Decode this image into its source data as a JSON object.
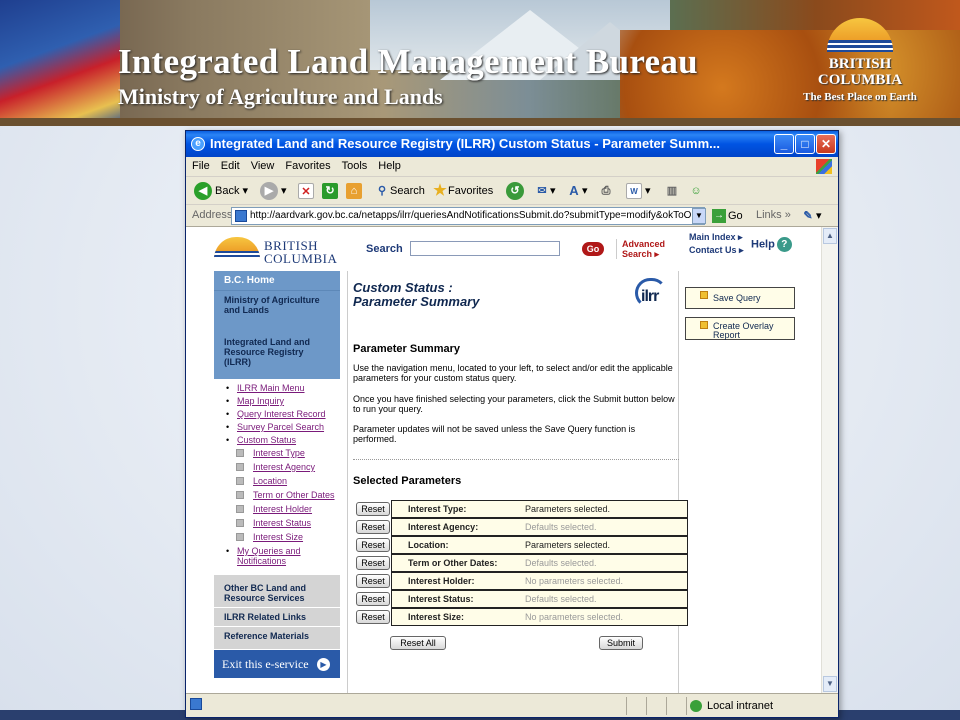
{
  "banner": {
    "title": "Integrated Land Management Bureau",
    "subtitle": "Ministry of Agriculture and Lands",
    "bc_name_1": "BRITISH",
    "bc_name_2": "COLUMBIA",
    "bc_tagline": "The Best Place on Earth"
  },
  "window": {
    "title": "Integrated Land and Resource Registry (ILRR) Custom Status - Parameter Summ...",
    "menu": [
      "File",
      "Edit",
      "View",
      "Favorites",
      "Tools",
      "Help"
    ],
    "toolbar": {
      "back": "Back",
      "search": "Search",
      "favorites": "Favorites"
    },
    "address_label": "Address",
    "address_url": "http://aardvark.gov.bc.ca/netapps/ilrr/queriesAndNotificationsSubmit.do?submitType=modify&okToO",
    "go_label": "Go",
    "links_label": "Links",
    "status_zone": "Local intranet"
  },
  "header": {
    "logo_line1": "BRITISH",
    "logo_line2": "COLUMBIA",
    "search_label": "Search",
    "search_value": "",
    "go_button": "Go",
    "advanced_1": "Advanced",
    "advanced_2": "Search ▸",
    "main_index": "Main Index ▸",
    "contact_us": "Contact Us ▸",
    "help": "Help"
  },
  "leftnav": {
    "bc_home": "B.C. Home",
    "ministry": "Ministry of Agriculture and Lands",
    "ilrr": "Integrated Land and Resource Registry (ILRR)",
    "links": [
      "ILRR Main Menu",
      "Map Inquiry",
      "Query Interest Record",
      "Survey Parcel Search",
      "Custom Status"
    ],
    "sub_links": [
      "Interest Type",
      "Interest Agency",
      "Location",
      "Term or Other Dates",
      "Interest Holder",
      "Interest Status",
      "Interest Size"
    ],
    "my_queries": "My Queries and Notifications",
    "other_services": "Other BC Land and Resource Services",
    "related_links": "ILRR Related Links",
    "reference": "Reference Materials",
    "exit": "Exit this e-service"
  },
  "main": {
    "title_1": "Custom Status :",
    "title_2": "Parameter Summary",
    "logo_text": "ilrr",
    "section_title": "Parameter Summary",
    "para_1": "Use the navigation menu, located to your left, to select and/or edit the applicable parameters for your custom status query.",
    "para_2": "Once you have finished selecting your parameters, click the Submit button below to run your query.",
    "para_3": "Parameter updates will not be saved unless the Save Query function is performed.",
    "selected_title": "Selected Parameters",
    "reset_label": "Reset",
    "parameters": [
      {
        "name": "Interest Type:",
        "value": "Parameters selected."
      },
      {
        "name": "Interest Agency:",
        "value": "Defaults selected."
      },
      {
        "name": "Location:",
        "value": "Parameters selected."
      },
      {
        "name": "Term or Other Dates:",
        "value": "Defaults selected."
      },
      {
        "name": "Interest Holder:",
        "value": "No parameters selected."
      },
      {
        "name": "Interest Status:",
        "value": "Defaults selected."
      },
      {
        "name": "Interest Size:",
        "value": "No parameters selected."
      }
    ],
    "reset_all": "Reset All",
    "submit": "Submit"
  },
  "right": {
    "save_query": "Save Query",
    "overlay_1": "Create Overlay",
    "overlay_2": "Report"
  }
}
